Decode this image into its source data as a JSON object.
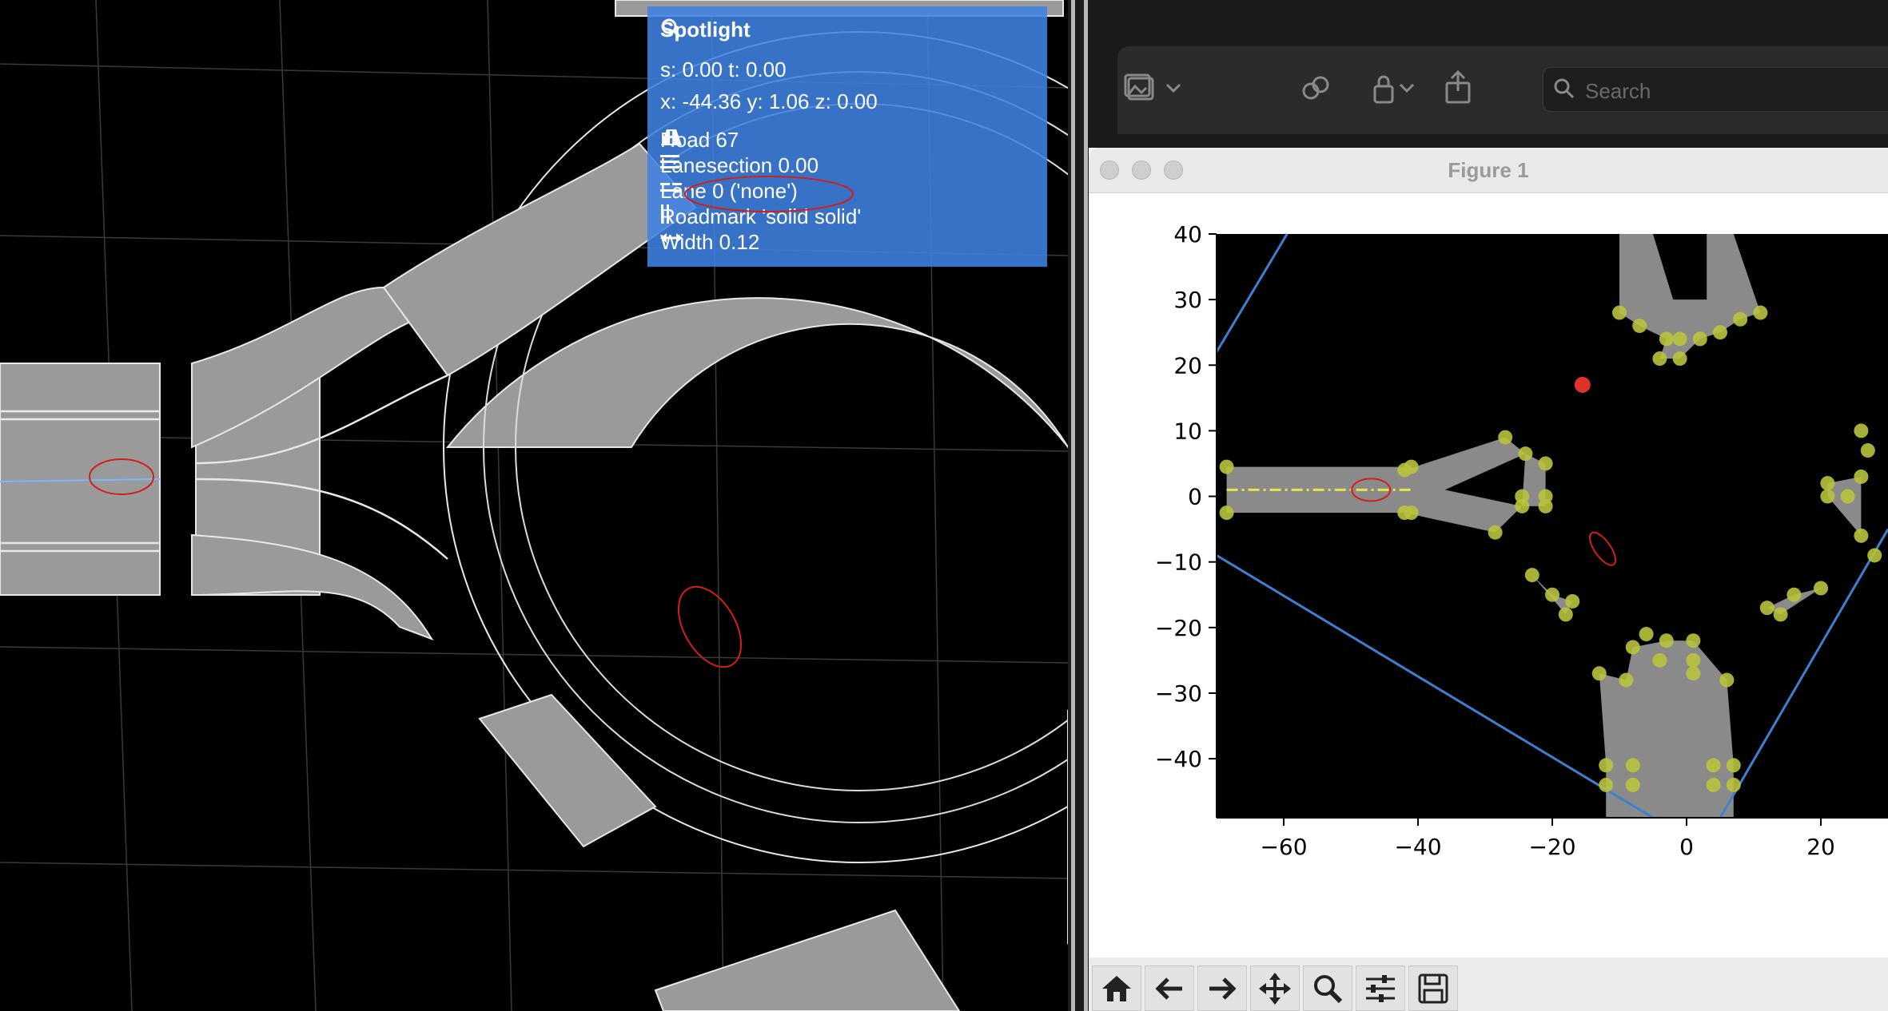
{
  "spotlight": {
    "title": "Spotlight",
    "st": "s: 0.00  t: 0.00",
    "xyz": "x: -44.36  y: 1.06  z: 0.00",
    "road": "Road 67",
    "lanesection": "Lanesection 0.00",
    "lane": "Lane 0 ('none')",
    "roadmark": "Roadmark 'solid solid'",
    "width": "Width 0.12"
  },
  "finder_toolbar": {
    "search_placeholder": "Search",
    "icons": [
      "gallery-icon",
      "chevron-down-icon",
      "link-icon",
      "lock-icon",
      "chevron-down-icon",
      "share-icon",
      "search-icon"
    ]
  },
  "figure_window": {
    "title": "Figure 1",
    "toolbar_buttons": [
      "home-icon",
      "back-icon",
      "forward-icon",
      "pan-icon",
      "zoom-icon",
      "configure-subplots-icon",
      "save-icon"
    ]
  },
  "chart_data": {
    "type": "scatter",
    "title": "",
    "xlabel": "",
    "ylabel": "",
    "xlim": [
      -70,
      30
    ],
    "ylim": [
      -49,
      40
    ],
    "xticks": [
      "−60",
      "−40",
      "−20",
      "0",
      "20"
    ],
    "yticks": [
      "40",
      "30",
      "20",
      "10",
      "0",
      "−10",
      "−20",
      "−30",
      "−40"
    ],
    "background": "#000000",
    "road_color": "#8a8a8a",
    "point_color": "#b8c23c",
    "marker": {
      "x": -15.5,
      "y": 17
    },
    "marker_color": "#e0322a",
    "centerline_color": "#e6e64a",
    "boundary_color": "#3f7fd0",
    "points": [
      [
        -68.5,
        4.5
      ],
      [
        -68.5,
        -2.5
      ],
      [
        -41,
        4.5
      ],
      [
        -41,
        -2.5
      ],
      [
        -42,
        4
      ],
      [
        -42,
        -2.5
      ],
      [
        -27,
        9
      ],
      [
        -28.5,
        -5.5
      ],
      [
        -24,
        6.5
      ],
      [
        -21,
        5
      ],
      [
        -24.5,
        0
      ],
      [
        -24.5,
        -1.5
      ],
      [
        -21,
        0
      ],
      [
        -21,
        -1.5
      ],
      [
        -10,
        28
      ],
      [
        -7,
        26
      ],
      [
        -3,
        24
      ],
      [
        -1,
        24
      ],
      [
        -4,
        21
      ],
      [
        -1,
        21
      ],
      [
        2,
        24
      ],
      [
        5,
        25
      ],
      [
        8,
        27
      ],
      [
        11,
        28
      ],
      [
        -23,
        -12
      ],
      [
        -17,
        -16
      ],
      [
        -18,
        -18
      ],
      [
        -20,
        -15
      ],
      [
        -8,
        -23
      ],
      [
        -6,
        -21
      ],
      [
        -3,
        -22
      ],
      [
        1,
        -22
      ],
      [
        -4,
        -25
      ],
      [
        1,
        -25
      ],
      [
        -13,
        -27
      ],
      [
        -9,
        -28
      ],
      [
        1,
        -27
      ],
      [
        6,
        -28
      ],
      [
        -12,
        -41
      ],
      [
        -12,
        -44
      ],
      [
        -8,
        -41
      ],
      [
        -8,
        -44
      ],
      [
        4,
        -41
      ],
      [
        4,
        -44
      ],
      [
        7,
        -41
      ],
      [
        7,
        -44
      ],
      [
        12,
        -17
      ],
      [
        14,
        -18
      ],
      [
        16,
        -15
      ],
      [
        20,
        -14
      ],
      [
        21,
        0
      ],
      [
        21,
        2
      ],
      [
        24,
        0
      ],
      [
        26,
        3
      ],
      [
        26,
        10
      ],
      [
        27,
        7
      ],
      [
        26,
        -6
      ],
      [
        28,
        -9
      ]
    ]
  }
}
